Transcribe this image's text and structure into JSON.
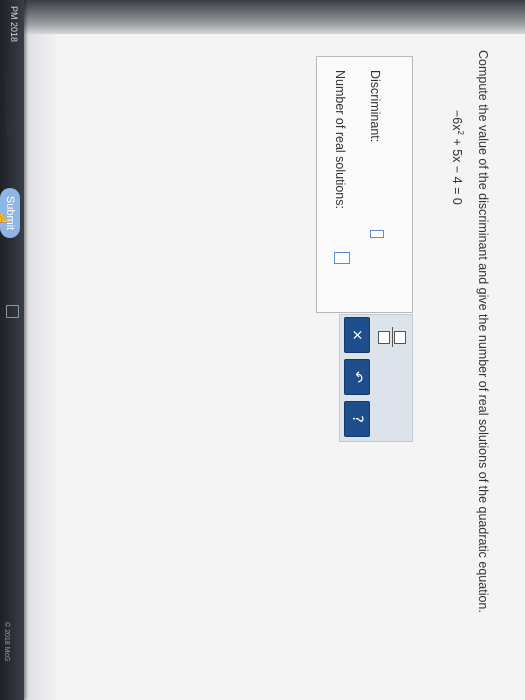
{
  "taskbar": {
    "clock_time": "PM",
    "clock_year": "2018"
  },
  "question": {
    "prompt": "Compute the value of the discriminant and give the number of real solutions of the quadratic equation.",
    "equation_lead": "−6x",
    "equation_exp": "2",
    "equation_rest": " + 5x − 4 = 0"
  },
  "answer": {
    "discriminant_label": "Discriminant:",
    "discriminant_value": "",
    "solutions_label": "Number of real solutions:",
    "solutions_value": ""
  },
  "keypad": {
    "clear": "×",
    "undo": "↶",
    "help": "?"
  },
  "footer": {
    "dont_know": "I Don't Know",
    "submit": "Submit",
    "copyright": "© 2018 McG"
  }
}
